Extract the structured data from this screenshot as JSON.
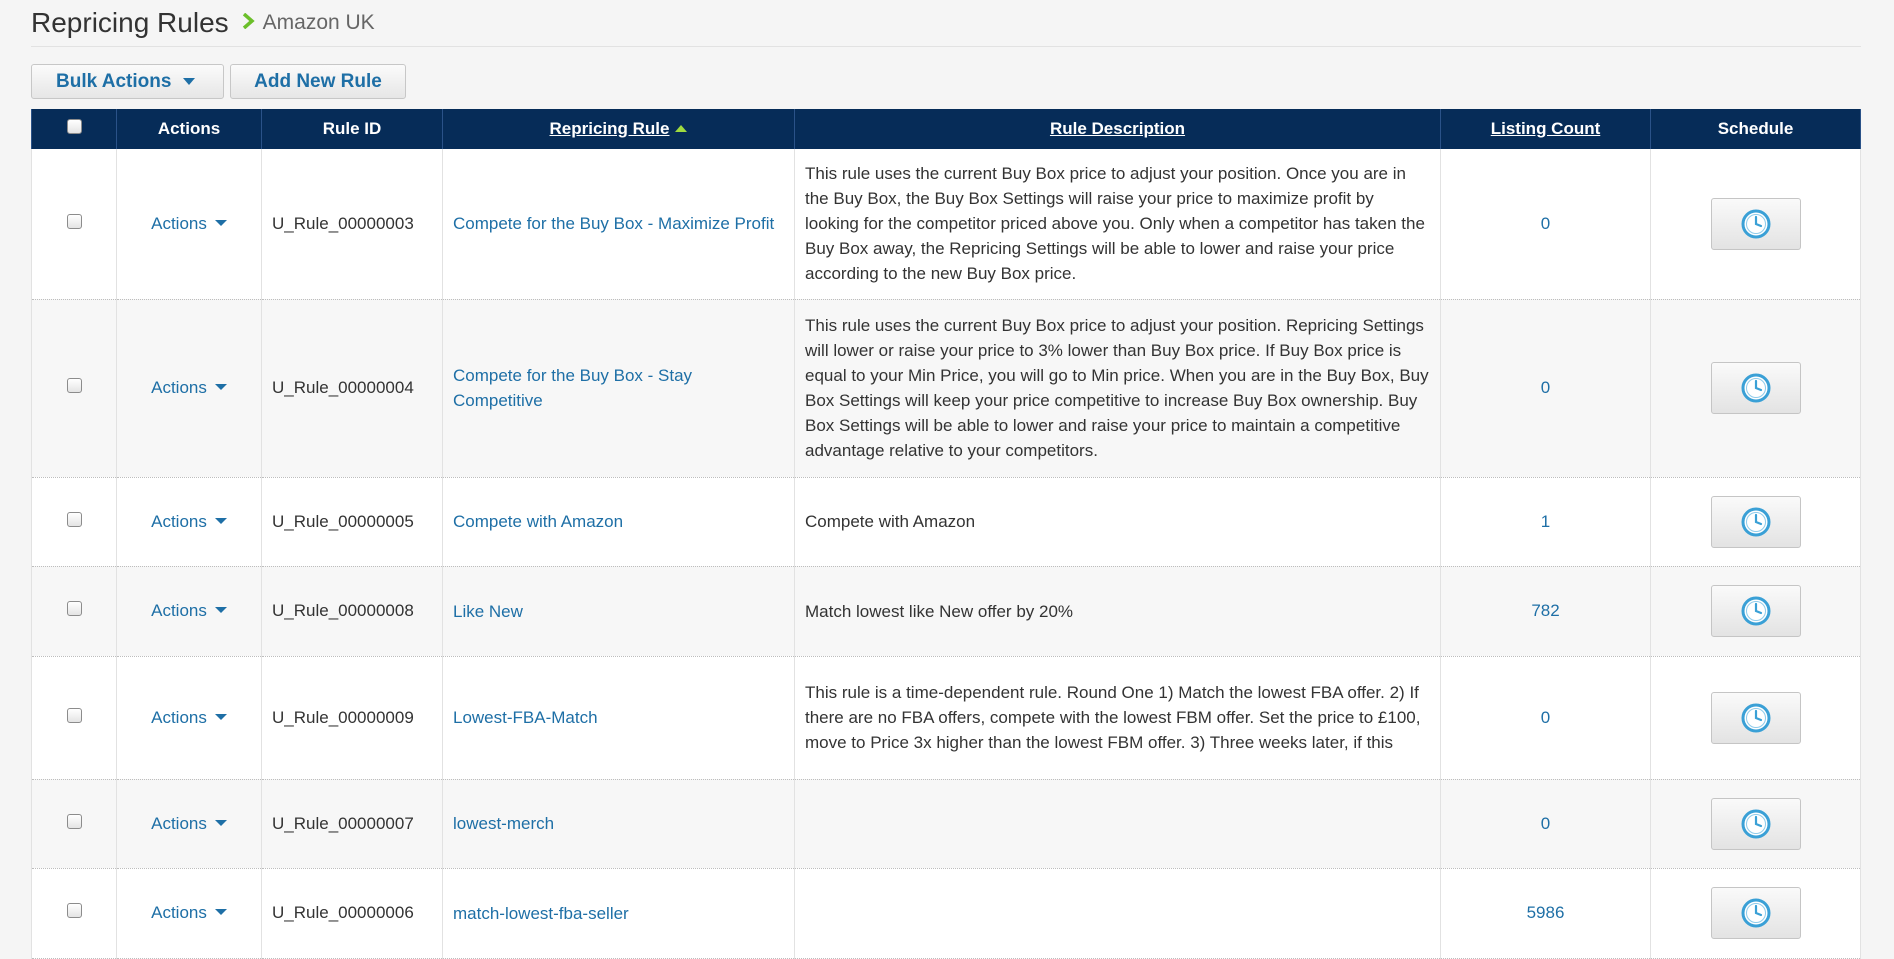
{
  "header": {
    "title": "Repricing Rules",
    "marketplace": "Amazon UK"
  },
  "toolbar": {
    "bulk_actions": "Bulk Actions",
    "add_rule": "Add New Rule"
  },
  "table": {
    "columns": {
      "actions": "Actions",
      "rule_id": "Rule ID",
      "repricing_rule": "Repricing Rule",
      "rule_description": "Rule Description",
      "listing_count": "Listing Count",
      "schedule": "Schedule"
    },
    "sort": {
      "column": "Repricing Rule",
      "direction": "ascending"
    },
    "rows": [
      {
        "actions": "Actions",
        "rule_id": "U_Rule_00000003",
        "rule": "Compete for the Buy Box - Maximize Profit",
        "description": "This rule uses the current Buy Box price to adjust your position. Once you are in the Buy Box, the Buy Box Settings will raise your price to maximize profit by looking for the competitor priced above you. Only when a competitor has taken the Buy Box away, the Repricing Settings will be able to lower and raise your price according to the new Buy Box price.",
        "count": "0"
      },
      {
        "actions": "Actions",
        "rule_id": "U_Rule_00000004",
        "rule": "Compete for the Buy Box - Stay Competitive",
        "description": "This rule uses the current Buy Box price to adjust your position. Repricing Settings will lower or raise your price to 3% lower than Buy Box price. If Buy Box price is equal to your Min Price, you will go to Min price. When you are in the Buy Box, Buy Box Settings will keep your price competitive to increase Buy Box ownership. Buy Box Settings will be able to lower and raise your price to maintain a competitive advantage relative to your competitors.",
        "count": "0"
      },
      {
        "actions": "Actions",
        "rule_id": "U_Rule_00000005",
        "rule": "Compete with Amazon",
        "description": "Compete with Amazon",
        "count": "1"
      },
      {
        "actions": "Actions",
        "rule_id": "U_Rule_00000008",
        "rule": "Like New",
        "description": "Match lowest like New offer by 20%",
        "count": "782"
      },
      {
        "actions": "Actions",
        "rule_id": "U_Rule_00000009",
        "rule": "Lowest-FBA-Match",
        "description": "This rule is a time-dependent rule. Round One 1) Match the lowest FBA offer. 2) If there are no FBA offers, compete with the lowest FBM offer. Set the price to £100, move to Price 3x higher than the lowest FBM offer. 3) Three weeks later, if this",
        "count": "0"
      },
      {
        "actions": "Actions",
        "rule_id": "U_Rule_00000007",
        "rule": "lowest-merch",
        "description": "",
        "count": "0"
      },
      {
        "actions": "Actions",
        "rule_id": "U_Rule_00000006",
        "rule": "match-lowest-fba-seller",
        "description": "",
        "count": "5986"
      }
    ]
  },
  "colors": {
    "header_bg": "#062c58",
    "link": "#1e6fa6",
    "sort_arrow": "#9fdb3f",
    "crumb_arrow": "#6bbf2a",
    "clock": "#3aa0d6"
  },
  "icons": {
    "breadcrumb": "chevron-right-icon",
    "schedule": "clock-icon",
    "sort": "sort-ascending-icon",
    "dropdown": "caret-down-icon"
  }
}
